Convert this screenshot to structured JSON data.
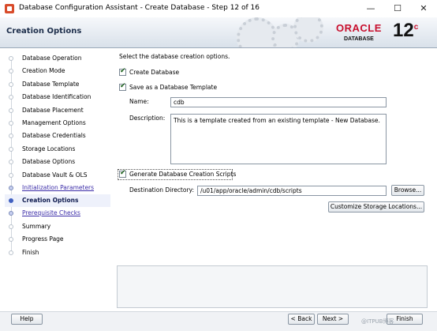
{
  "window": {
    "title": "Database Configuration Assistant - Create Database - Step 12 of 16",
    "controls": {
      "minimize": "—",
      "maximize": "☐",
      "close": "✕"
    }
  },
  "header": {
    "title": "Creation Options",
    "brand": "ORACLE",
    "brand_sub": "DATABASE",
    "version": "12",
    "version_sup": "c"
  },
  "steps": [
    {
      "label": "Database Operation",
      "state": "disabled"
    },
    {
      "label": "Creation Mode",
      "state": "disabled"
    },
    {
      "label": "Database Template",
      "state": "disabled"
    },
    {
      "label": "Database Identification",
      "state": "disabled"
    },
    {
      "label": "Database Placement",
      "state": "disabled"
    },
    {
      "label": "Management Options",
      "state": "disabled"
    },
    {
      "label": "Database Credentials",
      "state": "disabled"
    },
    {
      "label": "Storage Locations",
      "state": "disabled"
    },
    {
      "label": "Database Options",
      "state": "disabled"
    },
    {
      "label": "Database Vault & OLS",
      "state": "disabled"
    },
    {
      "label": "Initialization Parameters",
      "state": "link"
    },
    {
      "label": "Creation Options",
      "state": "current"
    },
    {
      "label": "Prerequisite Checks",
      "state": "link"
    },
    {
      "label": "Summary",
      "state": "disabled"
    },
    {
      "label": "Progress Page",
      "state": "disabled"
    },
    {
      "label": "Finish",
      "state": "disabled"
    }
  ],
  "main": {
    "intro": "Select the database creation options.",
    "create_database": {
      "label": "Create Database",
      "checked": true
    },
    "save_template": {
      "label": "Save as a Database Template",
      "checked": true
    },
    "name_label": "Name:",
    "name_value": "cdb",
    "description_label": "Description:",
    "description_value": "This is a template created from an existing template - New Database.",
    "gen_scripts": {
      "label": "Generate Database Creation Scripts",
      "checked": true
    },
    "dest_label": "Destination Directory:",
    "dest_value": "/u01/app/oracle/admin/cdb/scripts",
    "browse_label": "Browse...",
    "customize_label": "Customize Storage Locations..."
  },
  "footer": {
    "help": "Help",
    "back": "< Back",
    "next": "Next >",
    "finish": "Finish",
    "watermark": "@ITPUB博客"
  },
  "colors": {
    "oracle_red": "#c8102e",
    "current_step": "#0e1a4f",
    "link": "#3b2ca8"
  }
}
